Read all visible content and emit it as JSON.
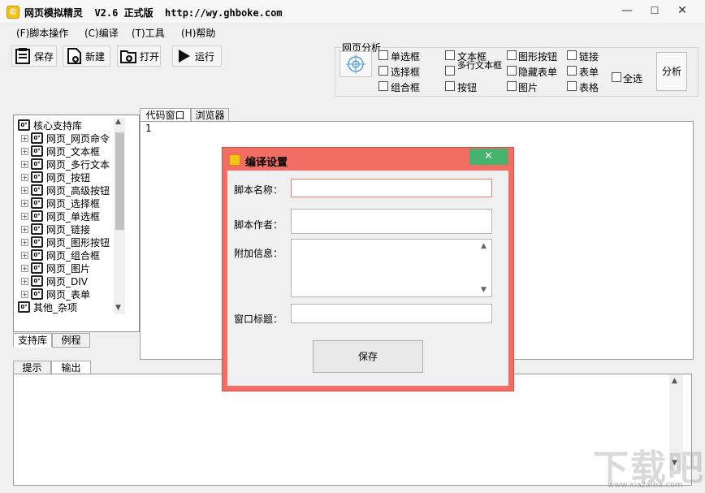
{
  "window": {
    "title": "网页模拟精灵  V2.6 正式版  http://wy.ghboke.com",
    "icon": "app-logo-icon",
    "controls": {
      "minimize": "—",
      "maximize": "☐",
      "close": "✕"
    }
  },
  "menu": [
    "(F)脚本操作",
    "(C)编译",
    "(T)工具",
    "(H)帮助"
  ],
  "toolbar": {
    "save": "保存",
    "new": "新建",
    "open": "打开",
    "run": "运行"
  },
  "analysis": {
    "legend": "网页分析",
    "checkboxes": [
      "单选框",
      "文本框",
      "图形按钮",
      "链接",
      "选择框",
      "多行文本框",
      "隐藏表单",
      "表单",
      "组合框",
      "按钮",
      "图片",
      "表格"
    ],
    "select_all": "全选",
    "analyze_button": "分析"
  },
  "tree": {
    "root": "核心支持库",
    "items": [
      "网页_网页命令",
      "网页_文本框",
      "网页_多行文本",
      "网页_按钮",
      "网页_高级按钮",
      "网页_选择框",
      "网页_单选框",
      "网页_链接",
      "网页_图形按钮",
      "网页_组合框",
      "网页_图片",
      "网页_DIV",
      "网页_表单"
    ],
    "other": "其他_杂项",
    "tabs": [
      "支持库",
      "例程"
    ]
  },
  "editor": {
    "tabs": [
      "代码窗口",
      "浏览器"
    ],
    "line_number": "1"
  },
  "output": {
    "tabs": [
      "提示",
      "输出"
    ]
  },
  "dialog": {
    "title": "编译设置",
    "close": "✕",
    "fields": {
      "script_name": "脚本名称：",
      "script_author": "脚本作者：",
      "extra_info": "附加信息：",
      "window_title": "窗口标题："
    },
    "save_button": "保存"
  },
  "watermark": {
    "text": "下载吧",
    "url": "www.xiazaiba.com"
  },
  "colors": {
    "dialog_border": "#f26d63",
    "dialog_close": "#44b36b",
    "name_field_border": "#e57f79"
  }
}
